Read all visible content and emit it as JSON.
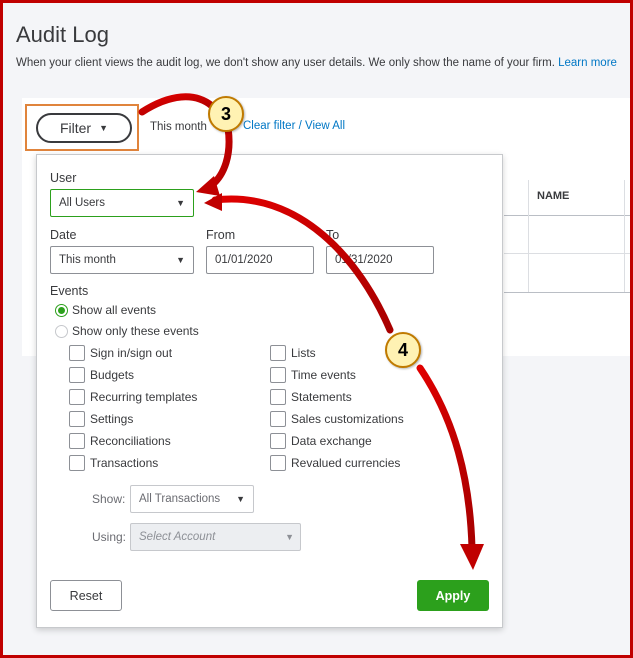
{
  "page": {
    "title": "Audit Log",
    "subtitle": "When your client views the audit log, we don't show any user details. We only show the name of your firm.",
    "subtitle_link": "Learn more"
  },
  "toolbar": {
    "filter_label": "Filter",
    "this_month_text": "This month",
    "clear_filter": "Clear filter / View All"
  },
  "table": {
    "columns": [
      "NAME"
    ]
  },
  "filter_panel": {
    "user_label": "User",
    "user_value": "All Users",
    "date_label": "Date",
    "date_value": "This month",
    "from_label": "From",
    "from_value": "01/01/2020",
    "to_label": "To",
    "to_value": "01/31/2020",
    "events_label": "Events",
    "radio_all": "Show all events",
    "radio_only": "Show only these events",
    "events_left": [
      "Sign in/sign out",
      "Budgets",
      "Recurring templates",
      "Settings",
      "Reconciliations",
      "Transactions"
    ],
    "events_right": [
      "Lists",
      "Time events",
      "Statements",
      "Sales customizations",
      "Data exchange",
      "Revalued currencies"
    ],
    "show_label": "Show:",
    "show_value": "All Transactions",
    "using_label": "Using:",
    "using_placeholder": "Select Account",
    "reset_label": "Reset",
    "apply_label": "Apply"
  },
  "annotations": {
    "step3": "3",
    "step4": "4"
  },
  "colors": {
    "accent_green": "#2ca01c",
    "link_blue": "#0077c5",
    "annotation_red": "#cc0000",
    "frame_red": "#c00000",
    "highlight_orange": "#e0843c"
  }
}
